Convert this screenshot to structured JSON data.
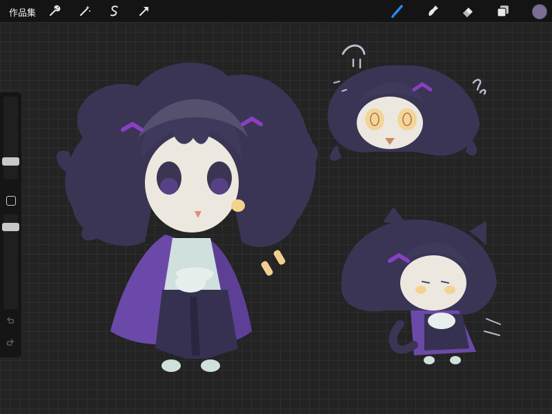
{
  "app": {
    "gallery_label": "作品集"
  },
  "toolbar": {
    "left_icons": [
      "wrench-icon",
      "magic-wand-icon",
      "selection-icon",
      "transform-arrow-icon"
    ],
    "right_icons": [
      "brush-icon",
      "smudge-icon",
      "eraser-icon",
      "layers-icon"
    ],
    "active_tool": "brush-icon",
    "active_tool_color": "#2a8df4",
    "current_color": "#7b6e93"
  },
  "sidebar": {
    "controls": [
      "brush-size-slider",
      "modify-button",
      "opacity-slider",
      "undo-icon",
      "redo-icon"
    ]
  },
  "artwork": {
    "colors": {
      "hair": "#3a3555",
      "hair_light": "#54506e",
      "skin": "#ece8e0",
      "cloak": "#6b49a8",
      "kimono": "#cfe0dd",
      "blush": "#f3d28a"
    }
  }
}
